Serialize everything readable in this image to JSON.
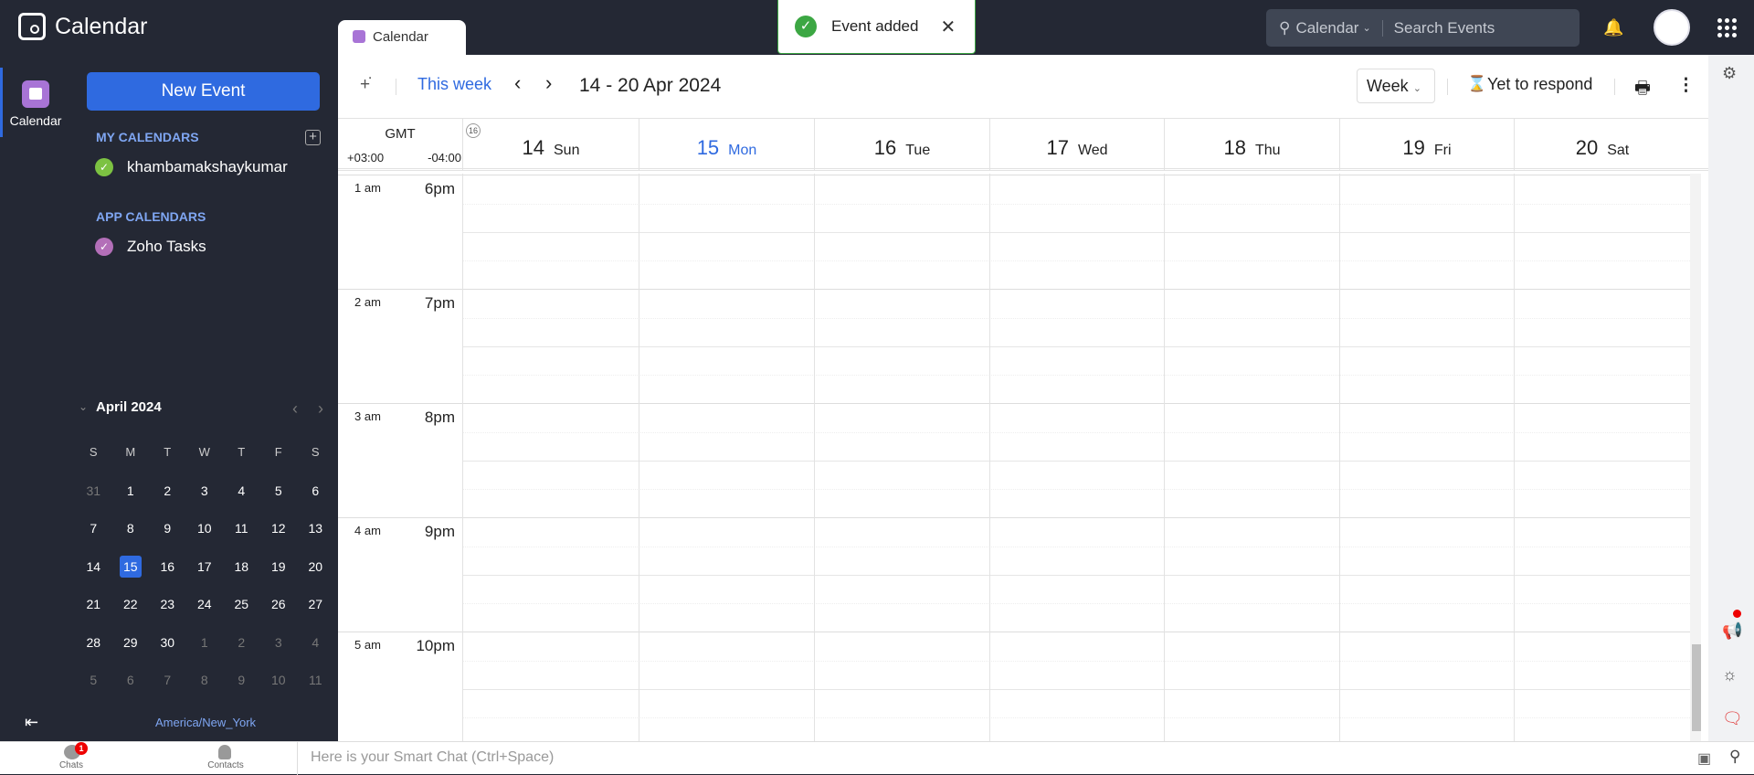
{
  "app": {
    "title": "Calendar",
    "tab": "Calendar"
  },
  "toast": {
    "message": "Event added"
  },
  "search": {
    "scope": "Calendar",
    "placeholder": "Search Events"
  },
  "rail": {
    "calendar_label": "Calendar"
  },
  "sidebar": {
    "new_event": "New Event",
    "my_calendars_heading": "MY CALENDARS",
    "my_calendars": [
      {
        "name": "khambamakshaykumar",
        "color": "#7cc242"
      }
    ],
    "app_calendars_heading": "APP CALENDARS",
    "app_calendars": [
      {
        "name": "Zoho Tasks",
        "color": "#b36fb8"
      }
    ],
    "mini": {
      "title": "April 2024",
      "weekdays": [
        "S",
        "M",
        "T",
        "W",
        "T",
        "F",
        "S"
      ],
      "weeks": [
        [
          "31",
          "1",
          "2",
          "3",
          "4",
          "5",
          "6"
        ],
        [
          "7",
          "8",
          "9",
          "10",
          "11",
          "12",
          "13"
        ],
        [
          "14",
          "15",
          "16",
          "17",
          "18",
          "19",
          "20"
        ],
        [
          "21",
          "22",
          "23",
          "24",
          "25",
          "26",
          "27"
        ],
        [
          "28",
          "29",
          "30",
          "1",
          "2",
          "3",
          "4"
        ],
        [
          "5",
          "6",
          "7",
          "8",
          "9",
          "10",
          "11"
        ]
      ],
      "today": "15"
    },
    "timezone": "America/New_York"
  },
  "toolbar": {
    "this_week": "This week",
    "range": "14 - 20 Apr 2024",
    "view": "Week",
    "yet_to_respond": "Yet to respond"
  },
  "grid": {
    "gmt": "GMT",
    "tz1": "+03:00",
    "tz2": "-04:00",
    "week_no": "16",
    "days": [
      {
        "n": "14",
        "w": "Sun"
      },
      {
        "n": "15",
        "w": "Mon",
        "today": true
      },
      {
        "n": "16",
        "w": "Tue"
      },
      {
        "n": "17",
        "w": "Wed"
      },
      {
        "n": "18",
        "w": "Thu"
      },
      {
        "n": "19",
        "w": "Fri"
      },
      {
        "n": "20",
        "w": "Sat"
      }
    ],
    "hours": [
      {
        "a": "1 am",
        "b": "6pm"
      },
      {
        "a": "2 am",
        "b": "7pm"
      },
      {
        "a": "3 am",
        "b": "8pm"
      },
      {
        "a": "4 am",
        "b": "9pm"
      },
      {
        "a": "5 am",
        "b": "10pm"
      }
    ]
  },
  "bottom": {
    "chats": "Chats",
    "chats_badge": "1",
    "contacts": "Contacts",
    "smart_chat": "Here is your Smart Chat (Ctrl+Space)"
  },
  "colors": {
    "accent": "#2f6ae0",
    "dark": "#242834",
    "success": "#3ca743",
    "event_purple": "#a874d6"
  }
}
